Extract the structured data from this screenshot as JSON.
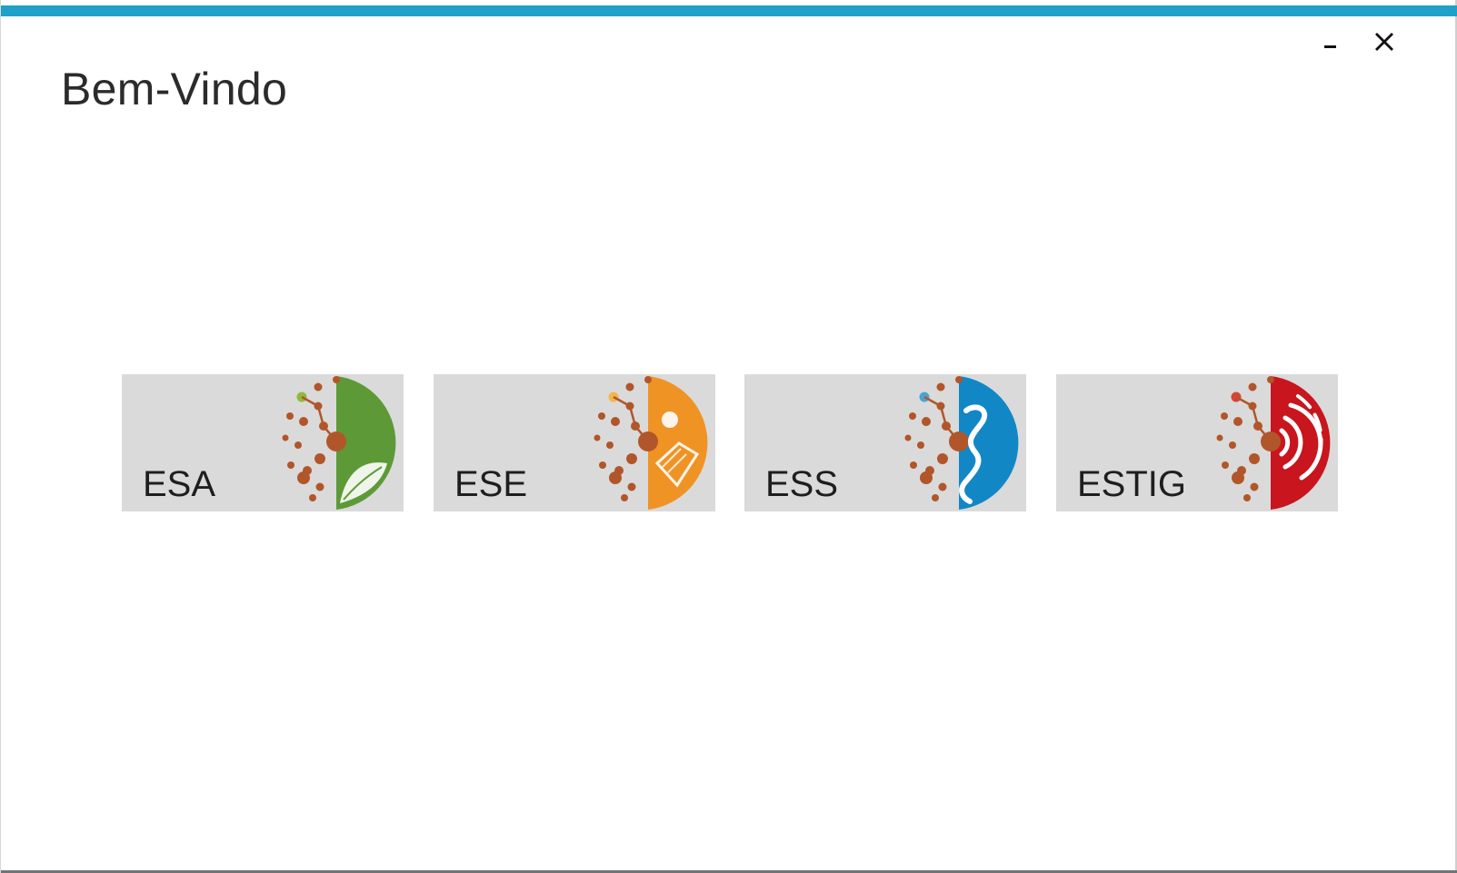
{
  "window": {
    "title": "Bem-Vindo",
    "accent_color": "#1ea0c8",
    "controls": {
      "minimize_icon": "minimize-icon",
      "close_icon": "close-icon"
    }
  },
  "schools": [
    {
      "label": "ESA",
      "color": "#5d9a37",
      "emblem": "leaf-icon"
    },
    {
      "label": "ESE",
      "color": "#ef9325",
      "emblem": "book-icon"
    },
    {
      "label": "ESS",
      "color": "#1187c6",
      "emblem": "serpent-icon"
    },
    {
      "label": "ESTIG",
      "color": "#c8151e",
      "emblem": "signal-waves-icon"
    }
  ],
  "dot_color": "#b1562a"
}
